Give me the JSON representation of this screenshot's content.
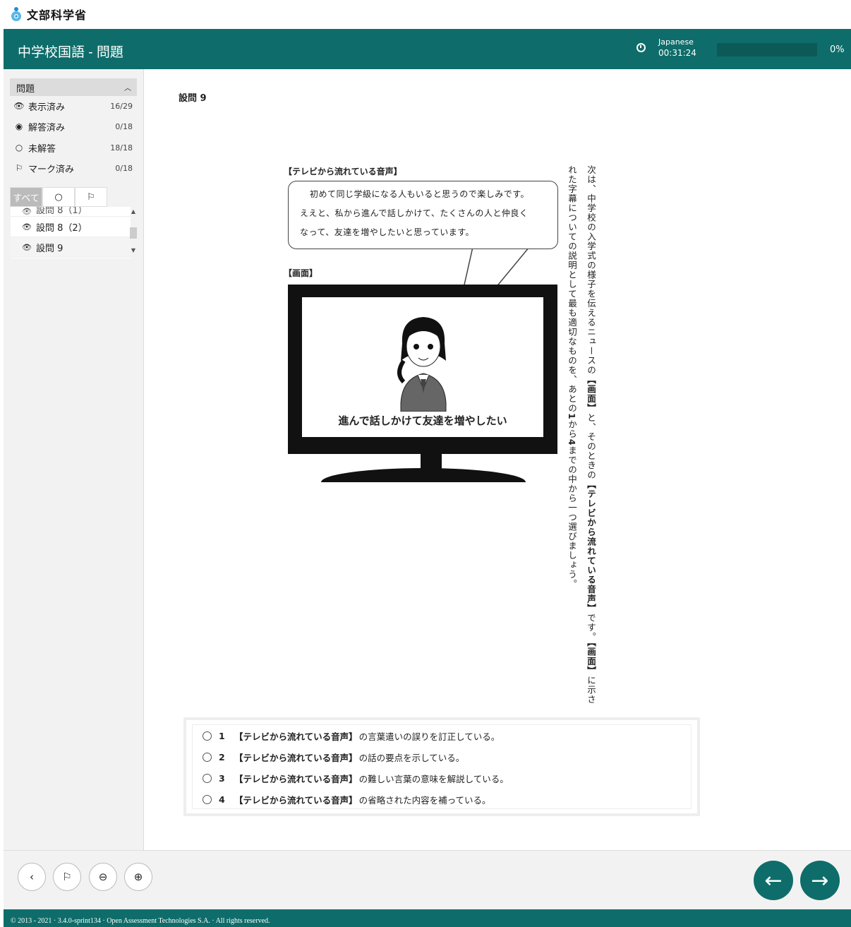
{
  "brand": {
    "name": "文部科学省"
  },
  "header": {
    "title": "中学校国語 - 問題",
    "language": "Japanese",
    "timer": "00:31:24",
    "progress_percent": 0,
    "progress_label": "0%"
  },
  "sidebar": {
    "section_title": "問題",
    "stats": [
      {
        "label": "表示済み",
        "count": "16/29"
      },
      {
        "label": "解答済み",
        "count": "0/18"
      },
      {
        "label": "未解答",
        "count": "18/18"
      },
      {
        "label": "マーク済み",
        "count": "0/18"
      }
    ],
    "filters": {
      "all": "すべて"
    },
    "items": [
      "設問 8（1）",
      "設問 8（2）",
      "設問 9"
    ]
  },
  "question": {
    "title": "設問 9",
    "caption_audio": "【テレビから流れている音声】",
    "bubble_lines": [
      "初めて同じ学級になる人もいると思うので楽しみです。",
      "ええと、私から進んで話しかけて、たくさんの人と仲良く",
      "なって、友達を増やしたいと思っています。"
    ],
    "caption_screen": "【画面】",
    "screen_caption": "進んで話しかけて友達を増やしたい",
    "prompt_col1_a": "次は、中学校の入学式の様子を伝えるニュースの",
    "prompt_col1_b": "【画面】",
    "prompt_col1_c": "と、そのときの",
    "prompt_col1_d": "【テレビから流れている音声】",
    "prompt_col1_e": "です。",
    "prompt_col1_f": "【画面】",
    "prompt_col1_g": "に示さ",
    "prompt_col2_a": "れた字幕についての説明として最も適切なものを、あとの",
    "prompt_col2_b": "1",
    "prompt_col2_c": "から",
    "prompt_col2_d": "4",
    "prompt_col2_e": "までの中から一つ選びましょう。",
    "choices": [
      {
        "num": "1",
        "keyword": "【テレビから流れている音声】",
        "text": "の言葉遣いの誤りを訂正している。"
      },
      {
        "num": "2",
        "keyword": "【テレビから流れている音声】",
        "text": "の話の要点を示している。"
      },
      {
        "num": "3",
        "keyword": "【テレビから流れている音声】",
        "text": "の難しい言葉の意味を解説している。"
      },
      {
        "num": "4",
        "keyword": "【テレビから流れている音声】",
        "text": "の省略された内容を補っている。"
      }
    ]
  },
  "footer": {
    "copyright": "© 2013 - 2021 · 3.4.0-sprint134 · Open Assessment Technologies S.A. · All rights reserved."
  },
  "colors": {
    "primary": "#0e6d6a"
  }
}
